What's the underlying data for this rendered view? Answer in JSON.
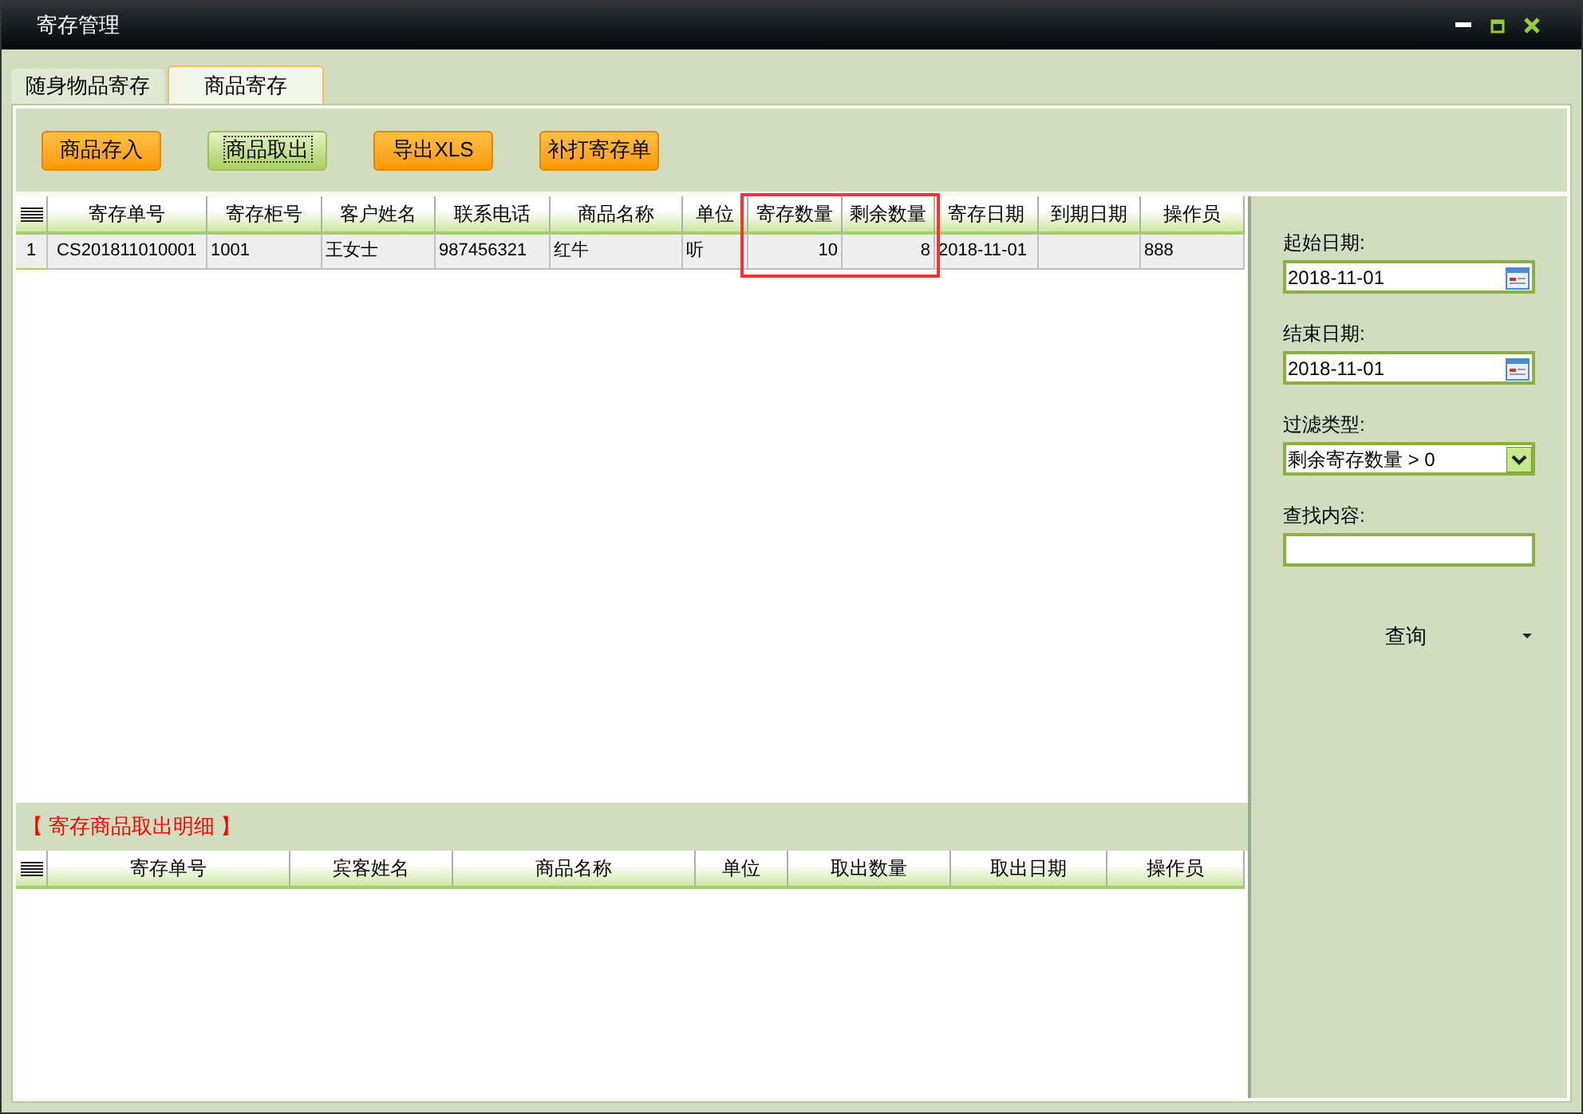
{
  "window": {
    "title": "寄存管理"
  },
  "tabs": [
    {
      "label": "随身物品寄存",
      "selected": false
    },
    {
      "label": "商品寄存",
      "selected": true
    }
  ],
  "toolbar": {
    "buttons": [
      {
        "label": "商品存入",
        "focused": false
      },
      {
        "label": "商品取出",
        "focused": true
      },
      {
        "label": "导出XLS",
        "focused": false
      },
      {
        "label": "补打寄存单",
        "focused": false
      }
    ]
  },
  "main_table": {
    "columns": [
      {
        "label": "寄存单号",
        "kind": "code",
        "highlighted": false
      },
      {
        "label": "寄存柜号",
        "kind": "text",
        "highlighted": false
      },
      {
        "label": "客户姓名",
        "kind": "text",
        "highlighted": false
      },
      {
        "label": "联系电话",
        "kind": "text",
        "highlighted": false
      },
      {
        "label": "商品名称",
        "kind": "text",
        "highlighted": false
      },
      {
        "label": "单位",
        "kind": "text",
        "highlighted": false
      },
      {
        "label": "寄存数量",
        "kind": "quantity",
        "highlighted": true
      },
      {
        "label": "剩余数量",
        "kind": "quantity",
        "highlighted": true
      },
      {
        "label": "寄存日期",
        "kind": "text",
        "highlighted": false
      },
      {
        "label": "到期日期",
        "kind": "text",
        "highlighted": false
      },
      {
        "label": "操作员",
        "kind": "text",
        "highlighted": false
      }
    ],
    "rows": [
      {
        "number": "1",
        "cells": [
          "CS201811010001",
          "1001",
          "王女士",
          "987456321",
          "红牛",
          "听",
          "10",
          "8",
          "2018-11-01",
          "",
          "888"
        ]
      }
    ]
  },
  "filters": [
    {
      "label": "起始日期:",
      "kind": "date",
      "value": "2018-11-01"
    },
    {
      "label": "结束日期:",
      "kind": "date",
      "value": "2018-11-01"
    },
    {
      "label": "过滤类型:",
      "kind": "select",
      "value": "剩余寄存数量 > 0"
    },
    {
      "label": "查找内容:",
      "kind": "text"
    }
  ],
  "query_button": {
    "label": "查询"
  },
  "detail": {
    "title": "【 寄存商品取出明细 】",
    "columns": [
      "寄存单号",
      "宾客姓名",
      "商品名称",
      "单位",
      "取出数量",
      "取出日期",
      "操作员"
    ]
  }
}
